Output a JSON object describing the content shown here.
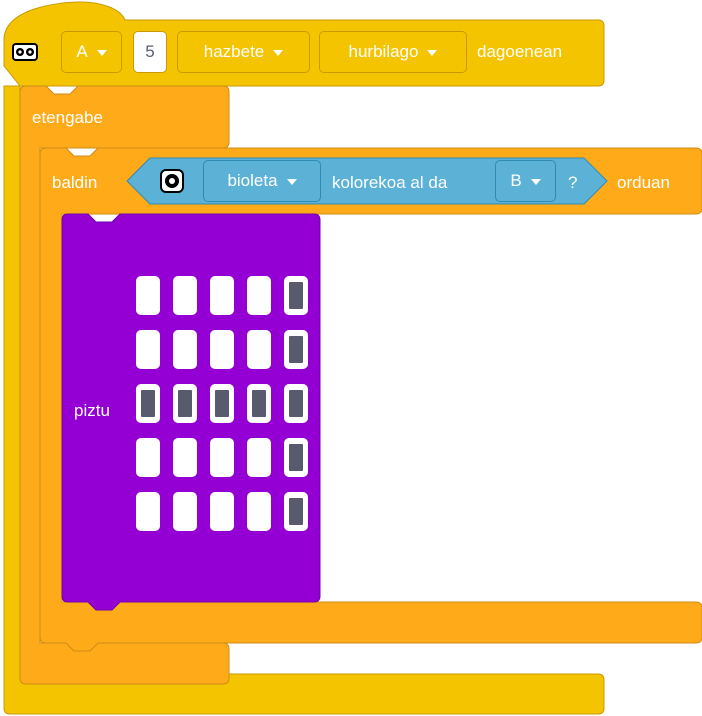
{
  "colors": {
    "event": "#f5c400",
    "control": "#ffab19",
    "sensor": "#5cb1d6",
    "light": "#9400d3",
    "pixel_on": "#585a6e",
    "pixel_off": "#ffffff"
  },
  "event_block": {
    "icon": "distance-sensor-icon",
    "port": "A",
    "distance": "5",
    "unit": "hazbete",
    "comparison": "hurbilago",
    "suffix": "dagoenean"
  },
  "forever_block": {
    "label": "etengabe"
  },
  "if_block": {
    "prefix": "baldin",
    "suffix": "orduan",
    "condition": {
      "icon": "color-sensor-icon",
      "color": "bioleta",
      "text": "kolorekoa al da",
      "port": "B",
      "question": "?"
    }
  },
  "light_block": {
    "label": "piztu",
    "matrix": [
      [
        0,
        0,
        0,
        0,
        1
      ],
      [
        0,
        0,
        0,
        0,
        1
      ],
      [
        1,
        1,
        1,
        1,
        1
      ],
      [
        0,
        0,
        0,
        0,
        1
      ],
      [
        0,
        0,
        0,
        0,
        1
      ]
    ]
  }
}
